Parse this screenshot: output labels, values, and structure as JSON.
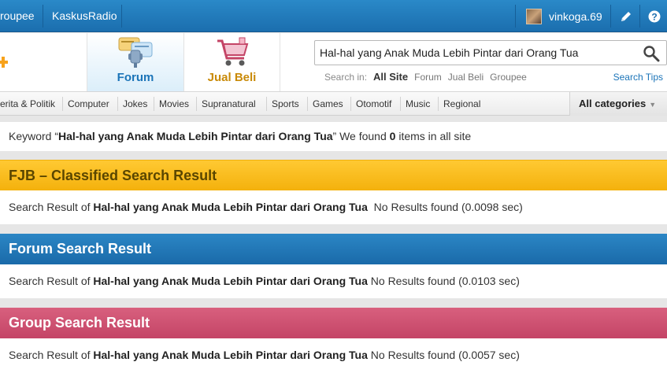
{
  "topbar": {
    "links": [
      "roupee",
      "KaskusRadio"
    ],
    "username": "vinkoga.69",
    "icons": [
      "pencil-icon",
      "help-icon"
    ]
  },
  "header": {
    "nav": [
      {
        "label": "Forum",
        "icon": "forum-icon"
      },
      {
        "label": "Jual Beli",
        "icon": "cart-icon"
      }
    ],
    "search": {
      "value": "Hal-hal yang Anak Muda Lebih Pintar dari Orang Tua",
      "search_in_label": "Search in:",
      "scopes": [
        "All Site",
        "Forum",
        "Jual Beli",
        "Groupee"
      ],
      "active_scope": "All Site",
      "tips": "Search Tips"
    }
  },
  "categories": {
    "items": [
      "erita & Politik",
      "Computer",
      "Jokes",
      "Movies",
      "Supranatural",
      "Sports",
      "Games",
      "Otomotif",
      "Music",
      "Regional"
    ],
    "all": "All categories"
  },
  "summary": {
    "prefix": "Keyword “",
    "keyword": "Hal-hal yang Anak Muda Lebih Pintar dari Orang Tua",
    "middle": "” We found ",
    "count": "0",
    "suffix": " items in all site"
  },
  "results": [
    {
      "title": "FJB – Classified Search Result",
      "prefix": "Search Result of ",
      "keyword": "Hal-hal yang Anak Muda Lebih Pintar dari Orang Tua",
      "status": "No Results found (0.0098 sec)",
      "color": "#f4b10c"
    },
    {
      "title": "Forum Search Result",
      "prefix": "Search Result of ",
      "keyword": "Hal-hal yang Anak Muda Lebih Pintar dari Orang Tua",
      "status": "No Results found (0.0103 sec)",
      "color": "#1a6aa9"
    },
    {
      "title": "Group Search Result",
      "prefix": "Search Result of ",
      "keyword": "Hal-hal yang Anak Muda Lebih Pintar dari Orang Tua",
      "status": "No Results found (0.0057 sec)",
      "color": "#c44466"
    }
  ]
}
